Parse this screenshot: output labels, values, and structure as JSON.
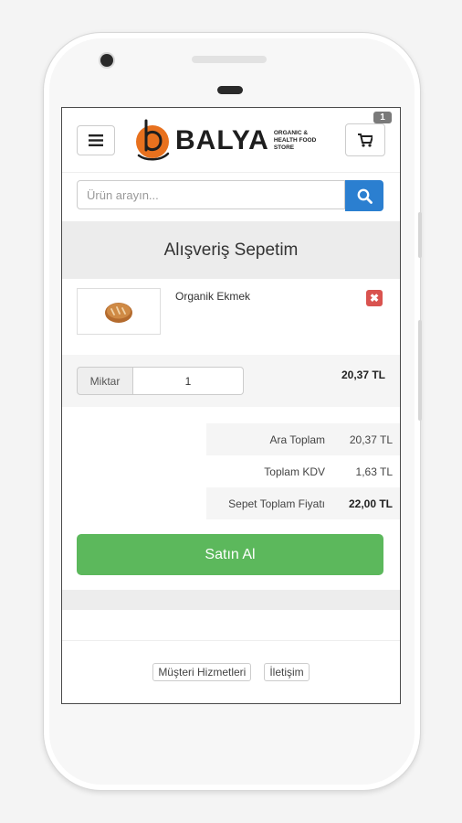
{
  "header": {
    "logo_text": "BALYA",
    "logo_sub": "ORGANIC & HEALTH FOOD STORE",
    "cart_count": "1"
  },
  "search": {
    "placeholder": "Ürün arayın..."
  },
  "page": {
    "title": "Alışveriş Sepetim"
  },
  "cart": {
    "items": [
      {
        "name": "Organik Ekmek",
        "quantity_label": "Miktar",
        "quantity": "1",
        "price": "20,37 TL",
        "remove_icon": "close-icon"
      }
    ]
  },
  "totals": {
    "subtotal_label": "Ara Toplam",
    "subtotal": "20,37 TL",
    "tax_label": "Toplam KDV",
    "tax": "1,63 TL",
    "total_label": "Sepet Toplam Fiyatı",
    "total": "22,00 TL"
  },
  "actions": {
    "buy_label": "Satın Al"
  },
  "footer": {
    "links": [
      "Müşteri Hizmetleri",
      "İletişim"
    ]
  },
  "colors": {
    "accent": "#2b7fd0",
    "buy": "#5cb85c",
    "remove": "#d9534f",
    "logo_orange": "#e8711e"
  }
}
